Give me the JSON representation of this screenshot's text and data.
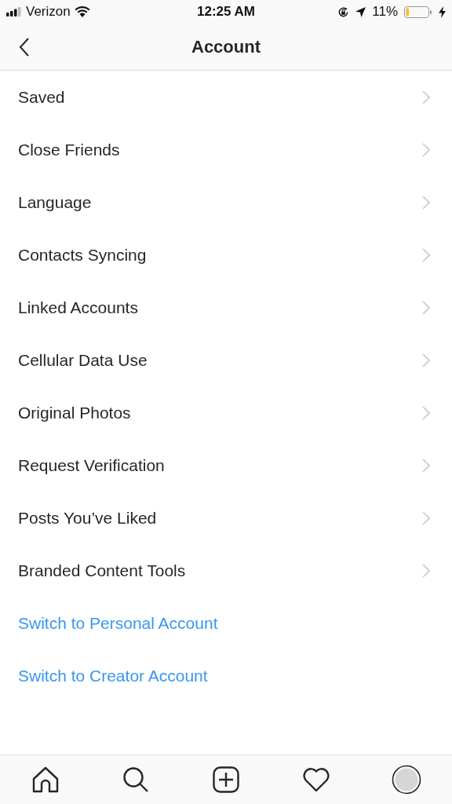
{
  "status_bar": {
    "carrier": "Verizon",
    "time": "12:25 AM",
    "battery": "11%"
  },
  "nav": {
    "title": "Account"
  },
  "items": [
    {
      "label": "Saved",
      "kind": "nav"
    },
    {
      "label": "Close Friends",
      "kind": "nav"
    },
    {
      "label": "Language",
      "kind": "nav"
    },
    {
      "label": "Contacts Syncing",
      "kind": "nav"
    },
    {
      "label": "Linked Accounts",
      "kind": "nav"
    },
    {
      "label": "Cellular Data Use",
      "kind": "nav"
    },
    {
      "label": "Original Photos",
      "kind": "nav"
    },
    {
      "label": "Request Verification",
      "kind": "nav"
    },
    {
      "label": "Posts You’ve Liked",
      "kind": "nav"
    },
    {
      "label": "Branded Content Tools",
      "kind": "nav"
    },
    {
      "label": "Switch to Personal Account",
      "kind": "link"
    },
    {
      "label": "Switch to Creator Account",
      "kind": "link"
    }
  ]
}
